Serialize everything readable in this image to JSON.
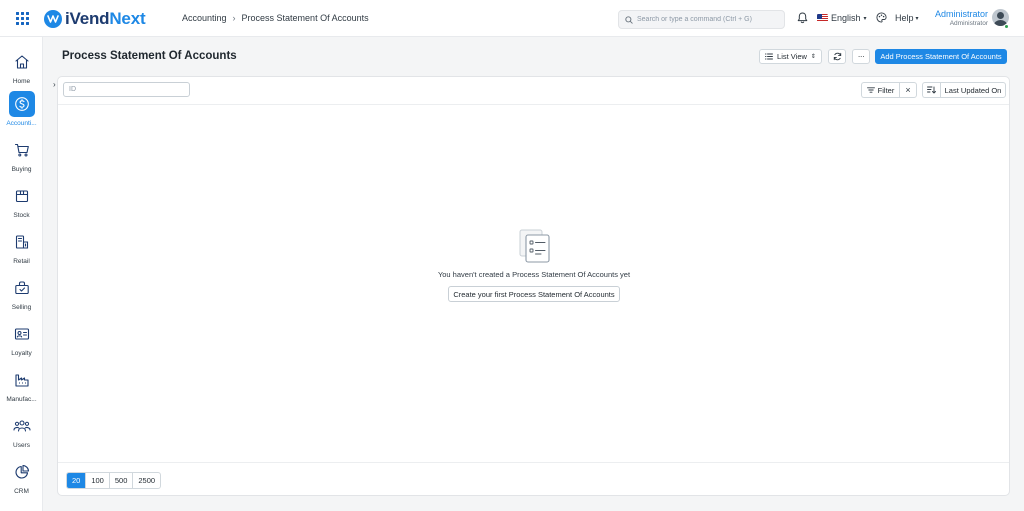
{
  "header": {
    "logo_brand": "iVend",
    "logo_accent": "Next",
    "breadcrumb": [
      "Accounting",
      "Process Statement Of Accounts"
    ],
    "search_placeholder": "Search or type a command (Ctrl + G)",
    "language": "English",
    "help_label": "Help",
    "user_name": "Administrator",
    "user_role": "Administrator"
  },
  "sidebar": {
    "items": [
      {
        "label": "Home",
        "icon": "home-icon",
        "active": false
      },
      {
        "label": "Accounti...",
        "icon": "dollar-icon",
        "active": true
      },
      {
        "label": "Buying",
        "icon": "cart-icon",
        "active": false
      },
      {
        "label": "Stock",
        "icon": "box-icon",
        "active": false
      },
      {
        "label": "Retail",
        "icon": "retail-icon",
        "active": false
      },
      {
        "label": "Selling",
        "icon": "selling-icon",
        "active": false
      },
      {
        "label": "Loyalty",
        "icon": "loyalty-card-icon",
        "active": false
      },
      {
        "label": "Manufac...",
        "icon": "factory-icon",
        "active": false
      },
      {
        "label": "Users",
        "icon": "users-icon",
        "active": false
      },
      {
        "label": "CRM",
        "icon": "pie-chart-icon",
        "active": false
      }
    ]
  },
  "page": {
    "title": "Process Statement Of Accounts",
    "view_label": "List View",
    "primary_action": "Add Process Statement Of Accounts",
    "id_placeholder": "ID",
    "filter_label": "Filter",
    "sort_label": "Last Updated On",
    "empty_message": "You haven't created a Process Statement Of Accounts yet",
    "empty_action": "Create your first Process Statement Of Accounts",
    "page_sizes": [
      "20",
      "100",
      "500",
      "2500"
    ],
    "active_page_size": "20"
  },
  "colors": {
    "accent": "#1e88e5",
    "brand_dark": "#1d3b6f",
    "background": "#f4f5f6"
  }
}
